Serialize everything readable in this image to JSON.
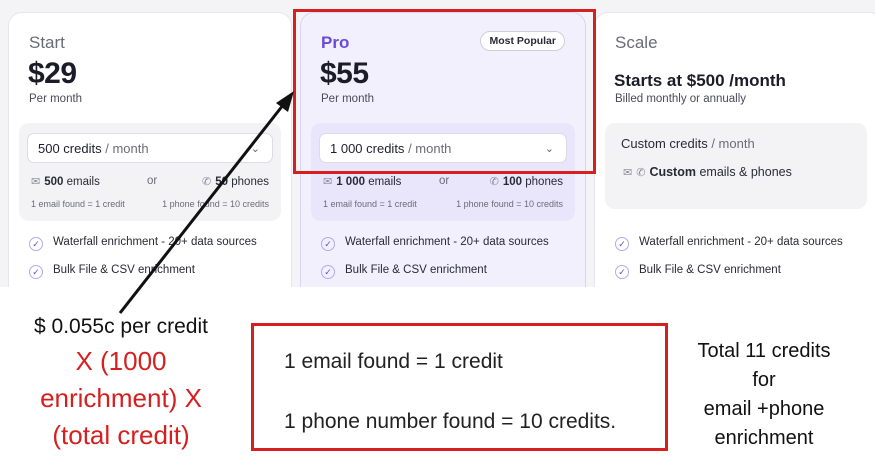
{
  "plans": {
    "start": {
      "name": "Start",
      "price": "$29",
      "period": "Per month",
      "credits_value": "500 credits",
      "credits_unit": "/ month",
      "emails_count": "500",
      "emails_label": "emails",
      "or": "or",
      "phones_count": "50",
      "phones_label": "phones",
      "email_note": "1 email found = 1 credit",
      "phone_note": "1 phone found = 10 credits",
      "feature_1": "Waterfall enrichment - 20+ data sources",
      "feature_2": "Bulk File & CSV enrichment"
    },
    "pro": {
      "name": "Pro",
      "badge": "Most Popular",
      "price": "$55",
      "period": "Per month",
      "credits_value": "1 000 credits",
      "credits_unit": "/ month",
      "emails_count": "1 000",
      "emails_label": "emails",
      "or": "or",
      "phones_count": "100",
      "phones_label": "phones",
      "email_note": "1 email found = 1 credit",
      "phone_note": "1 phone found = 10 credits",
      "feature_1": "Waterfall enrichment - 20+ data sources",
      "feature_2": "Bulk File & CSV enrichment"
    },
    "scale": {
      "name": "Scale",
      "price": "Starts at $500 /month",
      "period": "Billed monthly or annually",
      "custom_credits": "Custom credits",
      "custom_unit": "/ month",
      "custom_word": "Custom",
      "custom_usage": "emails & phones",
      "feature_1": "Waterfall enrichment - 20+ data sources",
      "feature_2": "Bulk File & CSV enrichment"
    }
  },
  "annotation": {
    "left_line1": "$ 0.055c per credit",
    "left_line2": "X (1000",
    "left_line3": "enrichment) X",
    "left_line4": "(total credit)",
    "box_line1": "1 email found = 1 credit",
    "box_line2": "1 phone number found = 10 credits.",
    "right_line1": "Total 11 credits",
    "right_line2": "for",
    "right_line3": "email +phone",
    "right_line4": "enrichment"
  },
  "colors": {
    "annotation_red": "#d62020",
    "pro_accent": "#6a4bd8"
  },
  "icons": [
    "mail-icon",
    "phone-icon",
    "chevron-down-icon",
    "check-circle-icon",
    "arrow-annotation"
  ]
}
